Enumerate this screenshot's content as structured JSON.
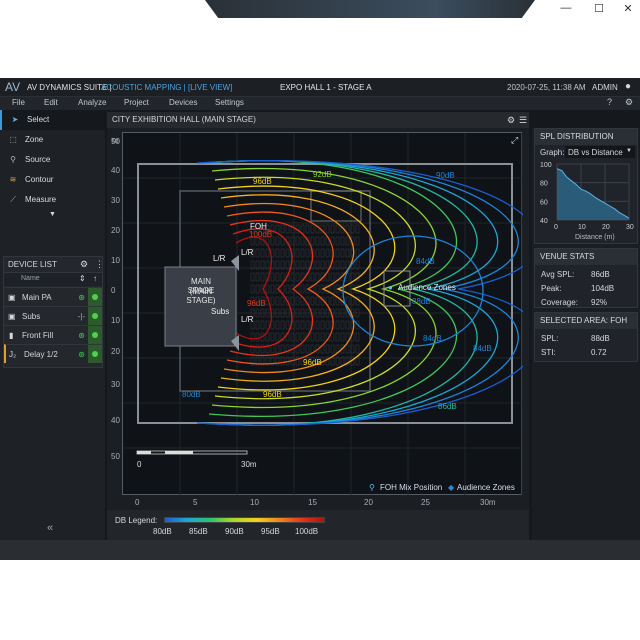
{
  "window": {
    "controls": [
      "minimize",
      "maximize",
      "close"
    ]
  },
  "titlebar": {
    "logo": "AV",
    "app": "AV DYNAMICS SUITE |",
    "mode": "ACOUSTIC MAPPING | [LIVE VIEW]",
    "venue": "EXPO HALL 1 - STAGE A",
    "datetime": "2020-07-25, 11:38 AM",
    "user": "ADMIN"
  },
  "menu": [
    "File",
    "Edit",
    "Analyze",
    "Project",
    "Devices",
    "Settings"
  ],
  "tools": [
    {
      "label": "Select",
      "icon": "cursor-icon",
      "active": true
    },
    {
      "label": "Zone",
      "icon": "dashed-square-icon"
    },
    {
      "label": "Source",
      "icon": "pin-icon"
    },
    {
      "label": "Contour",
      "icon": "contour-icon"
    },
    {
      "label": "Measure",
      "icon": "line-chart-icon"
    }
  ],
  "device_list": {
    "title": "DEVICE LIST",
    "col_name": "Name",
    "items": [
      {
        "name": "Main PA",
        "status": "linked"
      },
      {
        "name": "Subs",
        "status": "split"
      },
      {
        "name": "Front Fill",
        "status": "linked"
      },
      {
        "name": "Delay 1/2",
        "status": "linked"
      }
    ]
  },
  "map": {
    "title": "CITY EXHIBITION HALL (MAIN STAGE)",
    "y_unit": "m",
    "y_ticks": [
      "50",
      "40",
      "30",
      "20",
      "10",
      "0",
      "10",
      "20",
      "30",
      "40",
      "50"
    ],
    "x_ticks": [
      "0",
      "5",
      "10",
      "15",
      "20",
      "25",
      "30m"
    ],
    "labels": {
      "foh": "FOH",
      "stage": "MAIN STAGE",
      "stage_sub": "(MAIN STAGE)",
      "lr1": "L/R",
      "lr2": "L/R",
      "lr3": "L/R",
      "subs": "Subs",
      "zone": "Audience Zones"
    },
    "contour_labels": [
      "100dB",
      "96dB",
      "96dB",
      "92dB",
      "90dB",
      "84dB",
      "88dB",
      "84dB",
      "84dB",
      "96dB",
      "96dB",
      "80dB",
      "86dB"
    ],
    "scale": {
      "start": "0",
      "end": "30m"
    },
    "key": {
      "foh": "FOH Mix Position",
      "zones": "Audience Zones"
    }
  },
  "db_legend": {
    "label": "DB Legend:",
    "ticks": [
      "80dB",
      "85dB",
      "90dB",
      "95dB",
      "100dB"
    ],
    "colors": [
      "#1a5fd0",
      "#19a8d8",
      "#2fc36a",
      "#a8d62a",
      "#f2d21a",
      "#f08a1e",
      "#e8361a",
      "#b3120f"
    ]
  },
  "spl": {
    "title": "SPL DISTRIBUTION",
    "graph_label": "Graph:",
    "graph_value": "DB vs Distance",
    "chart_data": {
      "type": "area",
      "x": [
        0,
        2,
        4,
        6,
        8,
        10,
        12,
        14,
        16,
        18,
        20,
        22,
        24,
        26,
        28,
        30
      ],
      "y": [
        95,
        93,
        86,
        82,
        78,
        73,
        71,
        68,
        64,
        61,
        58,
        55,
        52,
        48,
        45,
        42
      ],
      "xlim": [
        0,
        30
      ],
      "ylim": [
        40,
        100
      ],
      "x_ticks": [
        "0",
        "10",
        "20",
        "30"
      ],
      "y_ticks": [
        "100",
        "80",
        "60",
        "40"
      ],
      "xlabel": "Distance (m)"
    }
  },
  "venue_stats": {
    "title": "VENUE STATS",
    "rows": [
      {
        "k": "Avg SPL:",
        "v": "86dB"
      },
      {
        "k": "Peak:",
        "v": "104dB"
      },
      {
        "k": "Coverage:",
        "v": "92%"
      }
    ]
  },
  "selected": {
    "title": "SELECTED AREA: FOH",
    "rows": [
      {
        "k": "SPL:",
        "v": "88dB"
      },
      {
        "k": "STI:",
        "v": "0.72"
      }
    ]
  }
}
